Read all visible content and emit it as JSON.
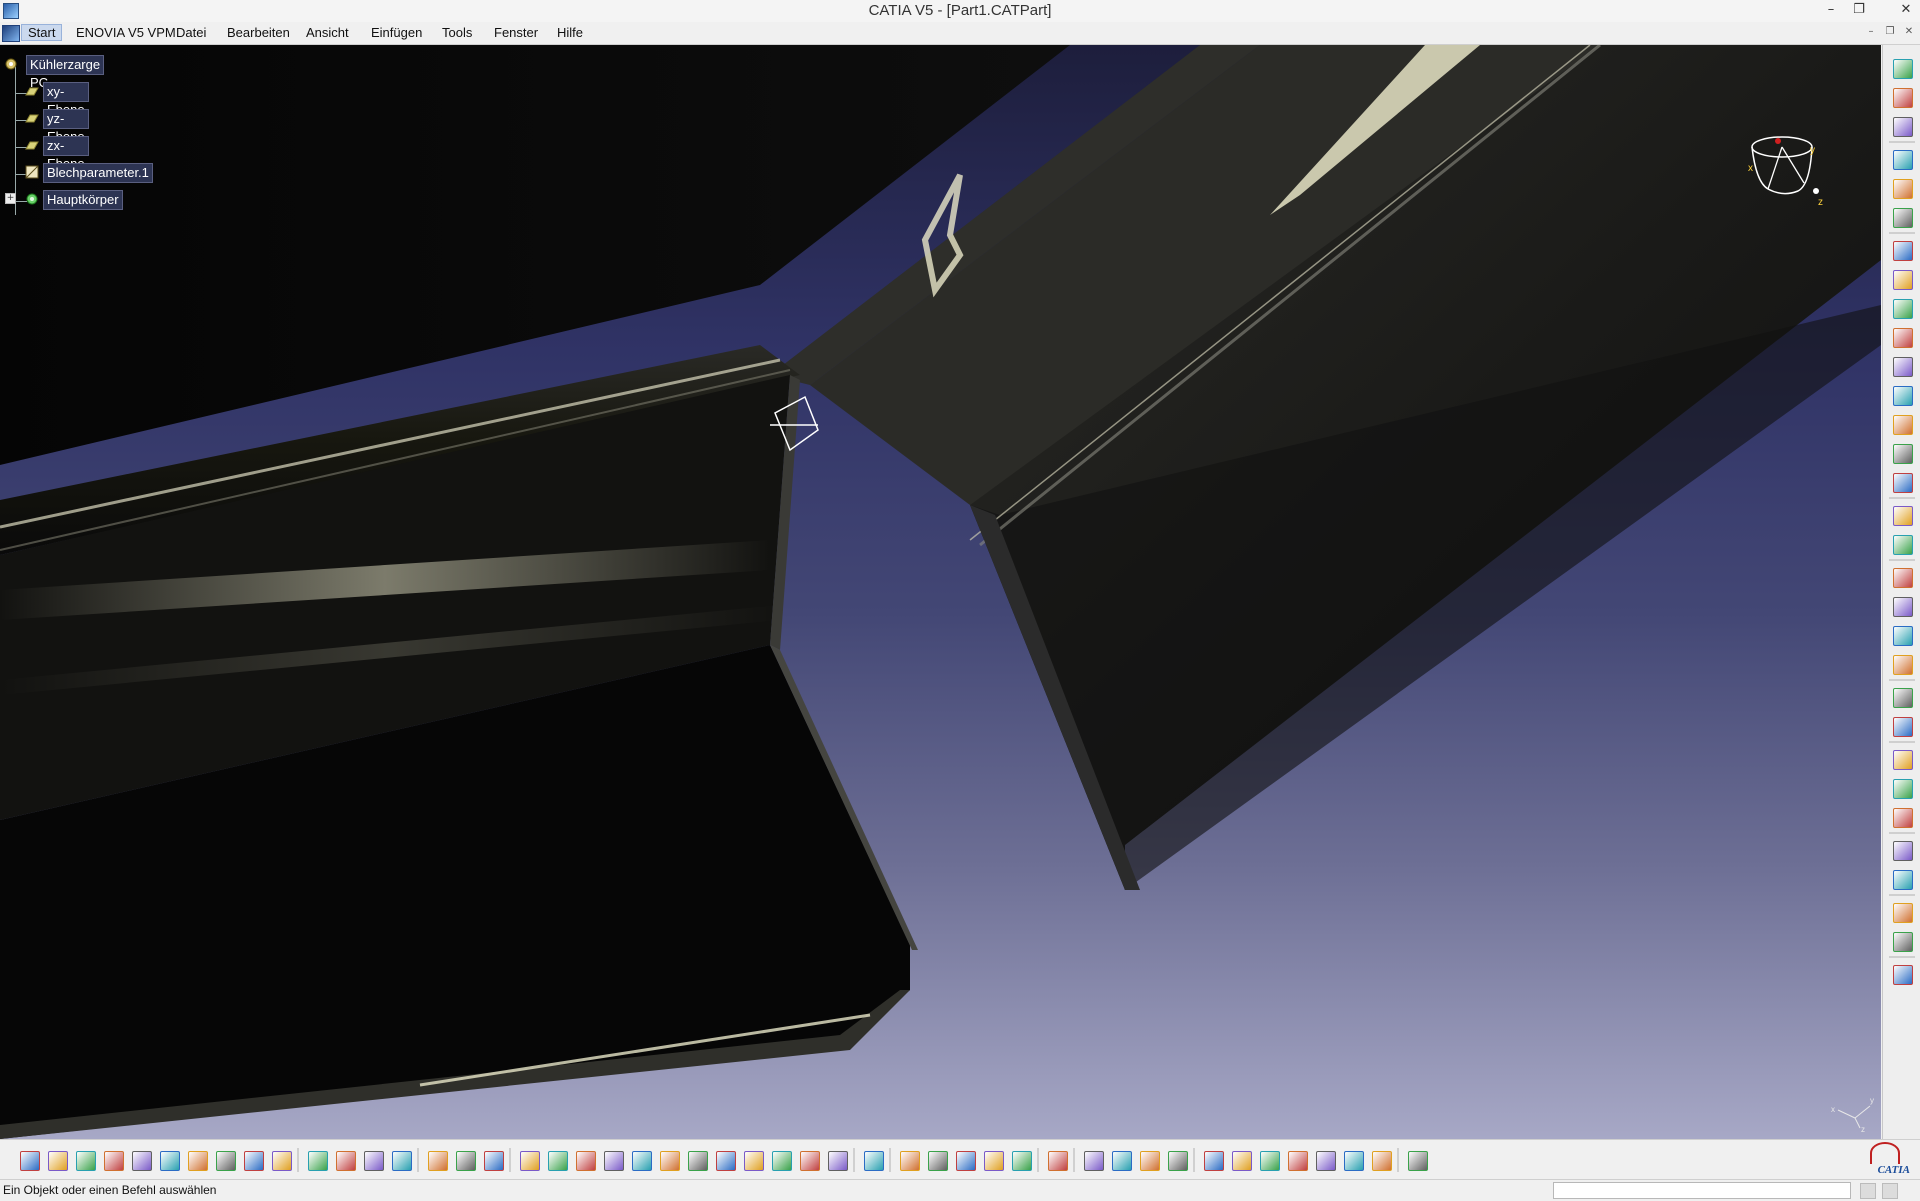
{
  "window": {
    "title": "CATIA V5 - [Part1.CATPart]",
    "minimize_glyph": "–",
    "restore_glyph": "❐",
    "close_glyph": "✕"
  },
  "menu": {
    "items": [
      "Start",
      "ENOVIA V5 VPM",
      "Datei",
      "Bearbeiten",
      "Ansicht",
      "Einfügen",
      "Tools",
      "Fenster",
      "Hilfe"
    ]
  },
  "tree": {
    "root": "Kühlerzarge PC",
    "children": [
      "xy-Ebene",
      "yz-Ebene",
      "zx-Ebene",
      "Blechparameter.1",
      "Hauptkörper"
    ],
    "expand_glyph": "+"
  },
  "compass": {
    "labels": [
      "x",
      "y",
      "z"
    ]
  },
  "axis_triad": {
    "labels": [
      "x",
      "y",
      "z"
    ]
  },
  "status": {
    "message": "Ein Objekt oder einen Befehl auswählen",
    "command_value": ""
  },
  "branding": {
    "logo_text": "CATIA"
  },
  "colors": {
    "background_top": "#1d1e3c",
    "background_bottom": "#a7a8c6",
    "tree_node_bg": "#2d3453",
    "part_body": "#0c0c0c",
    "highlight": "#e8e6c8",
    "accent_brand": "#1a4c9a"
  },
  "icons": {
    "toolbar_bottom": [
      "new-icon",
      "open-icon",
      "save-icon",
      "print-icon",
      "cut-icon",
      "copy-icon",
      "paste-icon",
      "undo-icon",
      "redo-icon",
      "whats-this-icon",
      "formula-icon",
      "knowledge-icon",
      "ruler-icon",
      "table-icon",
      "tree-icon",
      "measure-icon",
      "settings-icon",
      "fly-icon",
      "fit-all-icon",
      "pan-icon",
      "rotate-icon",
      "zoom-in-icon",
      "zoom-out-icon",
      "normal-view-icon",
      "multi-view-icon",
      "iso-view-icon",
      "shading-icon",
      "hide-show-icon",
      "swap-icon",
      "capture-icon",
      "dimension-icon",
      "axis-icon",
      "bolt-icon",
      "camera-icon",
      "hole-icon",
      "pocket-icon",
      "grid-icon",
      "material-icon",
      "sphere-icon",
      "hand-icon",
      "axis-system-icon",
      "snap-icon",
      "layer-icon",
      "plane-icon",
      "list-icon",
      "surface-icon",
      "stack-icon",
      "layers-icon"
    ],
    "toolbar_right": [
      "workbench-icon",
      "sheet-metal-icon",
      "sheet-param-icon",
      "select-icon",
      "sketch-icon",
      "wall-icon",
      "flange-icon",
      "hem-icon",
      "tear-icon",
      "bend-icon",
      "corner-icon",
      "chamfer-icon",
      "cut-out-icon",
      "hole-icon",
      "stamp-icon",
      "emboss-icon",
      "bead-icon",
      "pattern-icon",
      "mirror-icon",
      "unfold-icon",
      "fold-icon",
      "point-icon",
      "plane-icon",
      "body-icon",
      "solid-icon",
      "thickness-icon",
      "measure-icon",
      "apply-material-icon",
      "constraint-icon",
      "analysis-icon",
      "save-icon"
    ]
  }
}
